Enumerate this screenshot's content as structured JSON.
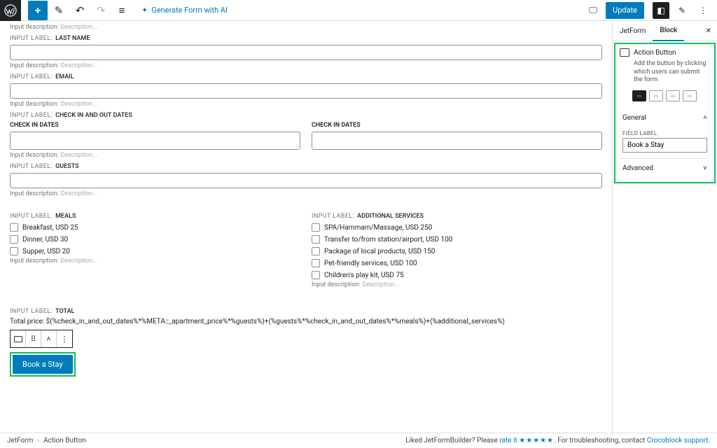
{
  "topbar": {
    "ai_label": "Generate Form with AI",
    "update_label": "Update"
  },
  "sidebar": {
    "tabs": {
      "jetform": "JetForm",
      "block": "Block"
    },
    "panel": {
      "title": "Action Button",
      "description": "Add the button by clicking which users can submit the form"
    },
    "sections": {
      "general": "General",
      "advanced": "Advanced"
    },
    "field_label_caption": "FIELD LABEL",
    "field_label_value": "Book a Stay"
  },
  "captions": {
    "input_label": "INPUT LABEL:",
    "input_description": "Input description:",
    "description_ph": "Description..."
  },
  "fields": {
    "first_desc": "Description...",
    "last_name": "LAST NAME",
    "email": "EMAIL",
    "check_dates": "CHECK IN AND OUT DATES",
    "check_sub": "CHECK IN DATES",
    "guests": "GUESTS",
    "meals": "MEALS",
    "additional": "ADDITIONAL SERVICES",
    "total": "TOTAL"
  },
  "meals": [
    "Breakfast, USD 25",
    "Dinner, USD 30",
    "Supper, USD 20"
  ],
  "services": [
    "SPA/Hammam/Massage, USD 250",
    "Transfer to/from station/airport, USD 100",
    "Package of local products, USD 150",
    "Pet-friendly services, USD 100",
    "Children's play kit, USD 75"
  ],
  "total_formula": "Total price: $(%check_in_and_out_dates%*%META::_apartment_price%*%guests%)+(%guests%*%check_in_and_out_dates%*%meals%)+(%additional_services%)",
  "book_button": "Book a Stay",
  "breadcrumb": {
    "root": "JetForm",
    "current": "Action Button"
  },
  "footer": {
    "liked": "Liked JetFormBuilder? Please ",
    "rate": "rate it",
    "trouble": ". For troubleshooting, contact ",
    "support": "Crocoblock support",
    "dot": "."
  }
}
